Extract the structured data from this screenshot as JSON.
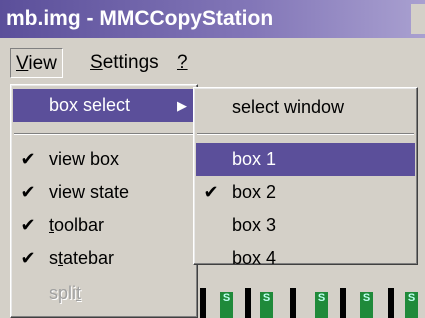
{
  "window": {
    "title": "mb.img - MMCCopyStation"
  },
  "menubar": {
    "view": {
      "label_before": "",
      "underline": "V",
      "label_after": "iew"
    },
    "settings": {
      "label_before": "",
      "underline": "S",
      "label_after": "ettings"
    },
    "help": {
      "label_before": "",
      "underline": "?",
      "label_after": ""
    }
  },
  "view_menu": {
    "box_select": {
      "label": "box select",
      "arrow": "▶"
    },
    "view_box": {
      "check": "✔",
      "label": "view box"
    },
    "view_state": {
      "check": "✔",
      "label": "view state"
    },
    "toolbar": {
      "check": "✔",
      "label_before": "",
      "underline": "t",
      "label_after": "oolbar"
    },
    "statebar": {
      "check": "✔",
      "label_before": "s",
      "underline": "t",
      "label_after": "atebar"
    },
    "split": {
      "label_before": "spli",
      "underline": "t",
      "label_after": ""
    }
  },
  "submenu": {
    "select_window": {
      "label": "select window"
    },
    "box1": {
      "check": "",
      "label": "box 1"
    },
    "box2": {
      "check": "✔",
      "label": "box 2"
    },
    "box3": {
      "check": "",
      "label": "box 3"
    },
    "box4": {
      "check": "",
      "label": "box 4"
    }
  },
  "canvas": {
    "cell_glyph": "S"
  },
  "colors": {
    "highlight": "#5b4f9a",
    "face": "#d4d0c8"
  }
}
